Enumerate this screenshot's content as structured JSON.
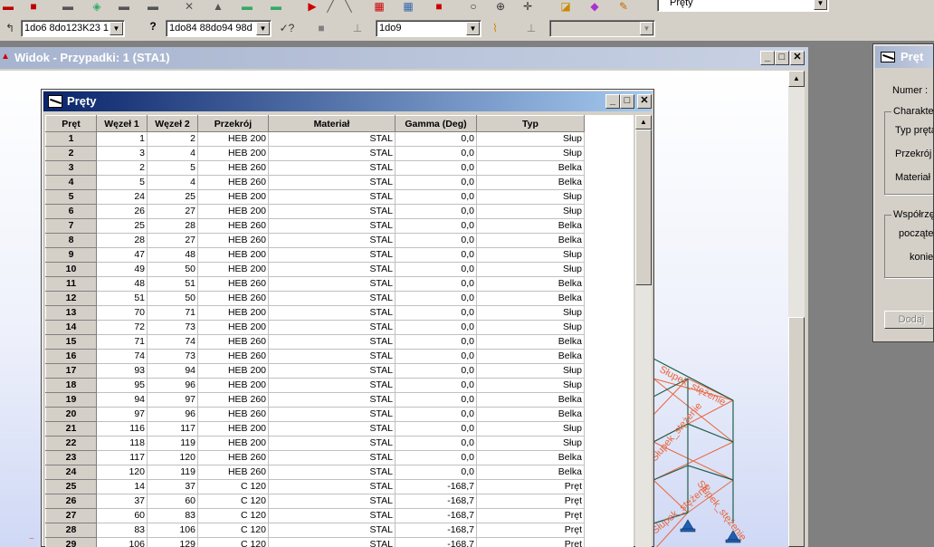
{
  "top_combo": {
    "value": "Pręty"
  },
  "toolbar": {
    "selection1": "1do6 8do123K23 1",
    "selection2": "1do84 88do94 98d",
    "selection3": "1do9",
    "selection4": ""
  },
  "view_window": {
    "title": "Widok - Przypadki: 1 (STA1)"
  },
  "bars_window": {
    "title": "Pręty",
    "columns": [
      "Pręt",
      "Węzeł 1",
      "Węzeł 2",
      "Przekrój",
      "Materiał",
      "Gamma (Deg)",
      "Typ"
    ],
    "rows": [
      [
        "1",
        "1",
        "2",
        "HEB 200",
        "STAL",
        "0,0",
        "Słup"
      ],
      [
        "2",
        "3",
        "4",
        "HEB 200",
        "STAL",
        "0,0",
        "Słup"
      ],
      [
        "3",
        "2",
        "5",
        "HEB 260",
        "STAL",
        "0,0",
        "Belka"
      ],
      [
        "4",
        "5",
        "4",
        "HEB 260",
        "STAL",
        "0,0",
        "Belka"
      ],
      [
        "5",
        "24",
        "25",
        "HEB 200",
        "STAL",
        "0,0",
        "Słup"
      ],
      [
        "6",
        "26",
        "27",
        "HEB 200",
        "STAL",
        "0,0",
        "Słup"
      ],
      [
        "7",
        "25",
        "28",
        "HEB 260",
        "STAL",
        "0,0",
        "Belka"
      ],
      [
        "8",
        "28",
        "27",
        "HEB 260",
        "STAL",
        "0,0",
        "Belka"
      ],
      [
        "9",
        "47",
        "48",
        "HEB 200",
        "STAL",
        "0,0",
        "Słup"
      ],
      [
        "10",
        "49",
        "50",
        "HEB 200",
        "STAL",
        "0,0",
        "Słup"
      ],
      [
        "11",
        "48",
        "51",
        "HEB 260",
        "STAL",
        "0,0",
        "Belka"
      ],
      [
        "12",
        "51",
        "50",
        "HEB 260",
        "STAL",
        "0,0",
        "Belka"
      ],
      [
        "13",
        "70",
        "71",
        "HEB 200",
        "STAL",
        "0,0",
        "Słup"
      ],
      [
        "14",
        "72",
        "73",
        "HEB 200",
        "STAL",
        "0,0",
        "Słup"
      ],
      [
        "15",
        "71",
        "74",
        "HEB 260",
        "STAL",
        "0,0",
        "Belka"
      ],
      [
        "16",
        "74",
        "73",
        "HEB 260",
        "STAL",
        "0,0",
        "Belka"
      ],
      [
        "17",
        "93",
        "94",
        "HEB 200",
        "STAL",
        "0,0",
        "Słup"
      ],
      [
        "18",
        "95",
        "96",
        "HEB 200",
        "STAL",
        "0,0",
        "Słup"
      ],
      [
        "19",
        "94",
        "97",
        "HEB 260",
        "STAL",
        "0,0",
        "Belka"
      ],
      [
        "20",
        "97",
        "96",
        "HEB 260",
        "STAL",
        "0,0",
        "Belka"
      ],
      [
        "21",
        "116",
        "117",
        "HEB 200",
        "STAL",
        "0,0",
        "Słup"
      ],
      [
        "22",
        "118",
        "119",
        "HEB 200",
        "STAL",
        "0,0",
        "Słup"
      ],
      [
        "23",
        "117",
        "120",
        "HEB 260",
        "STAL",
        "0,0",
        "Belka"
      ],
      [
        "24",
        "120",
        "119",
        "HEB 260",
        "STAL",
        "0,0",
        "Belka"
      ],
      [
        "25",
        "14",
        "37",
        "C 120",
        "STAL",
        "-168,7",
        "Pręt"
      ],
      [
        "26",
        "37",
        "60",
        "C 120",
        "STAL",
        "-168,7",
        "Pręt"
      ],
      [
        "27",
        "60",
        "83",
        "C 120",
        "STAL",
        "-168,7",
        "Pręt"
      ],
      [
        "28",
        "83",
        "106",
        "C 120",
        "STAL",
        "-168,7",
        "Pręt"
      ],
      [
        "29",
        "106",
        "129",
        "C 120",
        "STAL",
        "-168,7",
        "Pręt"
      ]
    ]
  },
  "structure_labels": [
    "Słupek_stężenie",
    "Słupek_stężenie",
    "Słupek_stężenie",
    "Słupek_stężenie"
  ],
  "prop_panel": {
    "title": "Pręt",
    "numer_label": "Numer :",
    "group1_label": "Charakter",
    "typ_label": "Typ pręta",
    "przekroj_label": "Przekrój :",
    "material_label": "Materiał",
    "group2_label": "Współrzę",
    "poczatek_label": "począte",
    "koniec_label": "konie",
    "add_button": "Dodaj"
  },
  "colors": {
    "active_title_start": "#0a246a",
    "active_title_end": "#a6caf0",
    "inactive_title_start": "#a7b4cf",
    "structure_frame": "#1f5f4a",
    "structure_bracing": "#e8663c",
    "support": "#2060b0"
  }
}
